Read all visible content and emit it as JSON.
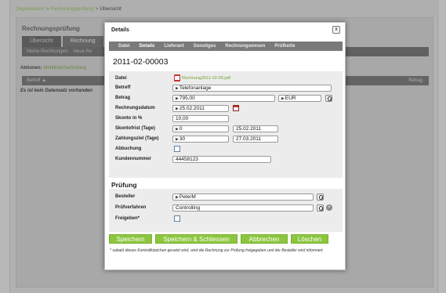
{
  "breadcrumb": {
    "items": [
      "Organisation",
      "Rechnungsprüfung",
      "Übersicht"
    ],
    "separator": ">"
  },
  "background": {
    "title": "Rechnungsprüfung",
    "tabs": [
      "Übersicht",
      "Rechnung"
    ],
    "subtabs": [
      "Meine Rechnungen",
      "Neue Re"
    ],
    "actions_label": "Aktionen:",
    "actions_link": "Merkliste/Sammlung",
    "table_col_left": "Betreff",
    "table_col_sort": "▲",
    "table_col_right": "Betrag",
    "empty_text": "Es ist kein Datensatz vorhanden"
  },
  "dialog": {
    "title": "Details",
    "close_glyph": "x",
    "tabs": [
      "Datei",
      "Details",
      "Lieferant",
      "Sonstiges",
      "Rechnungswesen",
      "Prüfkette"
    ],
    "record_title": "2011-02-00003",
    "fields": {
      "datei_label": "Datei",
      "datei_value": "Rechnung2011-02-09.pdf",
      "betreff_label": "Betreff",
      "betreff_value": "Telefonanlage",
      "betrag_label": "Betrag",
      "betrag_value": "795,00",
      "currency_value": "EUR",
      "rechnungsdatum_label": "Rechnungsdatum",
      "rechnungsdatum_value": "25.02.2011",
      "skonto_label": "Skonto in %",
      "skonto_value": "10,00",
      "skontofrist_label": "Skontofrist (Tage)",
      "skontofrist_value": "0",
      "skontofrist_date": "25.02.2011",
      "zahlungsziel_label": "Zahlungsziel (Tage)",
      "zahlungsziel_value": "30",
      "zahlungsziel_date": "27.03.2011",
      "abbuchung_label": "Abbuchung",
      "kundennummer_label": "Kundennummer",
      "kundennummer_value": "44458123"
    },
    "pruefung": {
      "heading": "Prüfung",
      "besteller_label": "Besteller",
      "besteller_value": "PeterM",
      "pruefverfahren_label": "Prüfverfahren",
      "pruefverfahren_value": "Controlling",
      "freigeben_label": "Freigeben*"
    },
    "buttons": {
      "save": "Speichern",
      "save_close": "Speichern & Schliessen",
      "cancel": "Abbrechen",
      "delete": "Löschen"
    },
    "footnote": "* sobald dieses Kontrollkästchen gesetzt wird, wird die Rechnung zur Prüfung freigegeben und der Besteller wird informiert."
  },
  "colors": {
    "accent": "#8cc63f",
    "dark_tab": "#5a5a5a",
    "link": "#6da22f"
  }
}
